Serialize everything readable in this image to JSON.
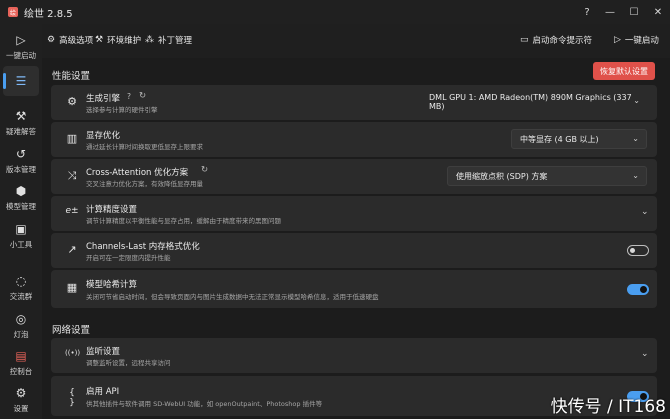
{
  "app": {
    "icon_glyph": "绘",
    "title": "绘世 2.8.5"
  },
  "window": {
    "help": "?",
    "minimize": "—",
    "maximize": "☐",
    "close": "✕"
  },
  "sidebar": {
    "items": [
      {
        "label": "一键启动",
        "icon": "▷"
      },
      {
        "label": "",
        "icon": "☰"
      },
      {
        "label": "疑难解答",
        "icon": "⚒"
      },
      {
        "label": "版本管理",
        "icon": "↺"
      },
      {
        "label": "模型管理",
        "icon": "⬢"
      },
      {
        "label": "小工具",
        "icon": "▣"
      },
      {
        "label": "交流群",
        "icon": "◌"
      },
      {
        "label": "灯泡",
        "icon": "◎"
      },
      {
        "label": "控制台",
        "icon": "▤"
      },
      {
        "label": "设置",
        "icon": "⚙"
      }
    ]
  },
  "topnav": {
    "tabs": [
      {
        "label": "高级选项",
        "icon": "⚙"
      },
      {
        "label": "环境维护",
        "icon": "⚒"
      },
      {
        "label": "补丁管理",
        "icon": "⁂"
      }
    ],
    "console_button": {
      "label": "启动命令提示符",
      "icon": "▭"
    },
    "launch_button": {
      "label": "一键启动",
      "icon": "▷"
    }
  },
  "performance": {
    "title": "性能设置",
    "reset_label": "恢复默认设置",
    "engine": {
      "title": "生成引擎",
      "icon": "⚙",
      "help": "?",
      "refresh": "↻",
      "subtitle": "选择参与计算的硬件引擎",
      "value": "DML GPU 1: AMD Radeon(TM) 890M Graphics (337 MB)"
    },
    "vram": {
      "title": "显存优化",
      "icon": "▥",
      "subtitle": "通过延长计算时间换取更低显存上限要求",
      "value": "中等显存 (4 GB 以上)"
    },
    "attention": {
      "title": "Cross-Attention 优化方案",
      "icon": "⤨",
      "refresh": "↻",
      "subtitle": "交叉注意力优化方案，有效降低显存用量",
      "value": "使用缩放点积 (SDP) 方案"
    },
    "precision": {
      "title": "计算精度设置",
      "icon": "e±",
      "subtitle": "调节计算精度以平衡性能与显存占用，缓解由于精度带来的黑图问题"
    },
    "channels_last": {
      "title": "Channels-Last 内存格式优化",
      "icon": "↗",
      "subtitle": "开启可在一定限度内提升性能",
      "enabled": false
    },
    "model_hash": {
      "title": "模型哈希计算",
      "icon": "▦",
      "subtitle": "关闭可节省启动时间，但会导致页面内与图片生成数据中无法正常显示模型哈希信息，适用于低速硬盘",
      "enabled": true
    }
  },
  "network": {
    "title": "网络设置",
    "listen": {
      "title": "监听设置",
      "icon": "((•))",
      "subtitle": "调整监听设置，远程共享访问"
    },
    "api": {
      "title": "启用 API",
      "icon": "{ }",
      "subtitle": "供其他插件与软件调用 SD-WebUI 功能，如 openOutpaint、Photoshop 插件等",
      "enabled": true
    }
  },
  "watermark": "快传号 / IT168",
  "colors": {
    "accent": "#4a9ef0",
    "danger": "#e0514a",
    "card": "#2b2b2b",
    "bg": "#1c1c1c"
  }
}
